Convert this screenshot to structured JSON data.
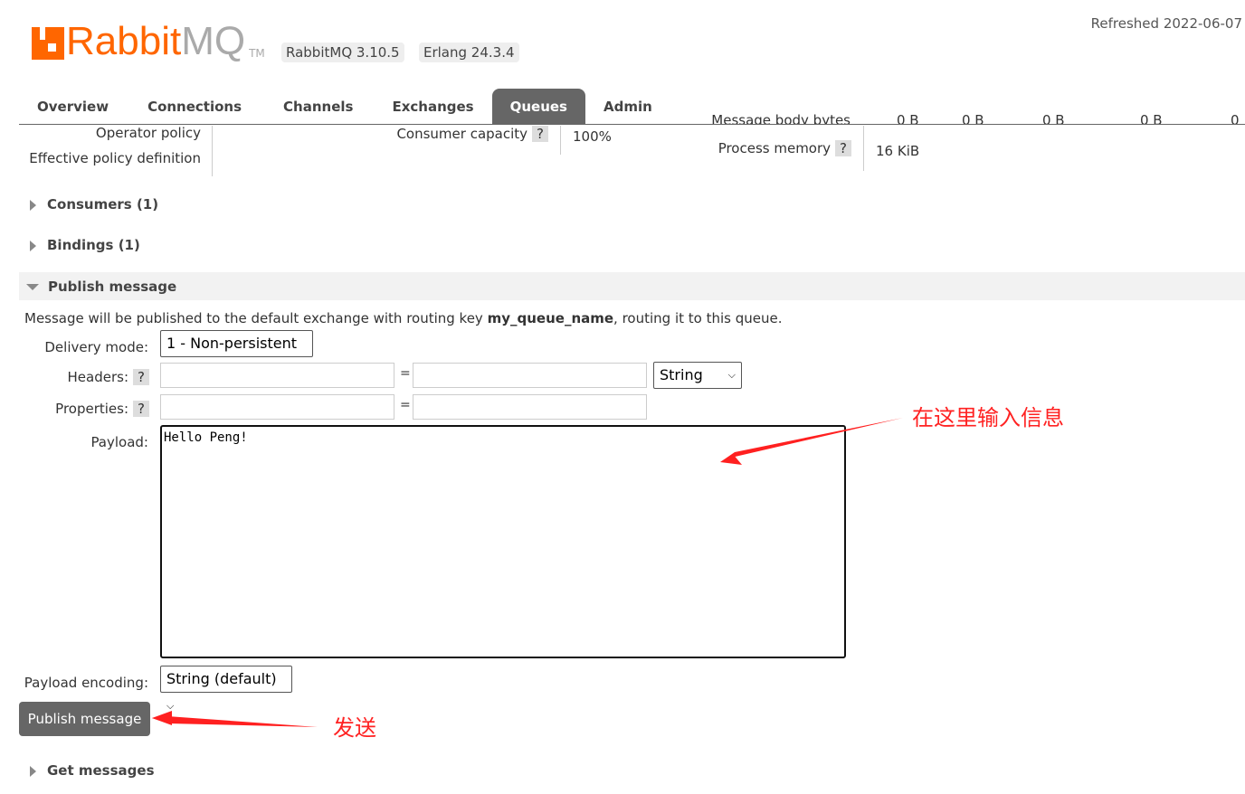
{
  "header": {
    "logo_text_a": "Rabbit",
    "logo_text_b": "MQ",
    "logo_tm": "TM",
    "rabbitmq_version": "RabbitMQ 3.10.5",
    "erlang_version": "Erlang 24.3.4",
    "refreshed": "Refreshed 2022-06-07"
  },
  "nav": {
    "tabs": [
      {
        "label": "Overview"
      },
      {
        "label": "Connections"
      },
      {
        "label": "Channels"
      },
      {
        "label": "Exchanges"
      },
      {
        "label": "Queues",
        "active": true
      },
      {
        "label": "Admin"
      }
    ]
  },
  "details": {
    "operator_policy": "Operator policy",
    "effective_policy": "Effective policy definition",
    "consumer_capacity_label": "Consumer capacity",
    "consumer_capacity_value": "100%",
    "message_body_bytes_label": "Message body bytes",
    "message_body_bytes_values": [
      "0 B",
      "0 B",
      "0 B",
      "0 B",
      "0"
    ],
    "process_memory_label": "Process memory",
    "process_memory_value": "16 KiB",
    "help": "?"
  },
  "sections": {
    "consumers": "Consumers (1)",
    "bindings": "Bindings (1)",
    "publish": "Publish message",
    "get": "Get messages"
  },
  "publish": {
    "info_prefix": "Message will be published to the default exchange with routing key ",
    "routing_key": "my_queue_name",
    "info_suffix": ", routing it to this queue.",
    "delivery_mode_label": "Delivery mode:",
    "delivery_mode_value": "1 - Non-persistent",
    "headers_label": "Headers:",
    "properties_label": "Properties:",
    "equals": "=",
    "header_type": "String",
    "payload_label": "Payload:",
    "payload_value": "Hello Peng!",
    "encoding_label": "Payload encoding:",
    "encoding_value": "String (default)",
    "button": "Publish message"
  },
  "annotations": {
    "input_note": "在这里输入信息",
    "send_note": "发送",
    "color": "#ff2020"
  }
}
